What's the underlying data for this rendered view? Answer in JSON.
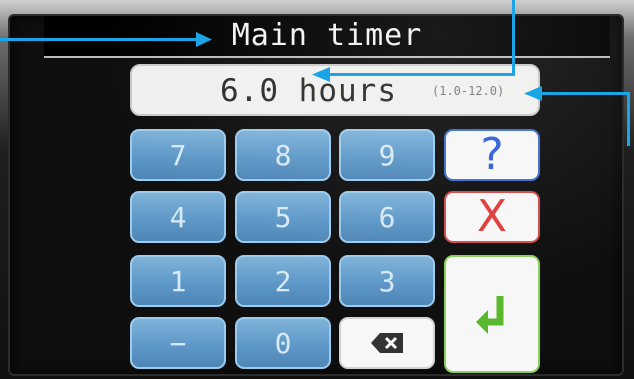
{
  "header": {
    "title": "Main timer"
  },
  "value_display": {
    "value": "6.0",
    "unit": "hours",
    "range": "(1.0-12.0)"
  },
  "keypad": {
    "keys": {
      "k7": "7",
      "k8": "8",
      "k9": "9",
      "k4": "4",
      "k5": "5",
      "k6": "6",
      "k1": "1",
      "k2": "2",
      "k3": "3",
      "minus": "−",
      "k0": "0",
      "help": "?",
      "cancel": "X"
    },
    "icons": {
      "backspace": "backspace-icon",
      "enter": "enter-icon"
    },
    "colors": {
      "number_key": "#5e98c8",
      "help": "#2f5fd8",
      "cancel": "#e23a3a",
      "enter": "#5ab82e"
    }
  },
  "callouts": {
    "color": "#1aa6e6"
  }
}
